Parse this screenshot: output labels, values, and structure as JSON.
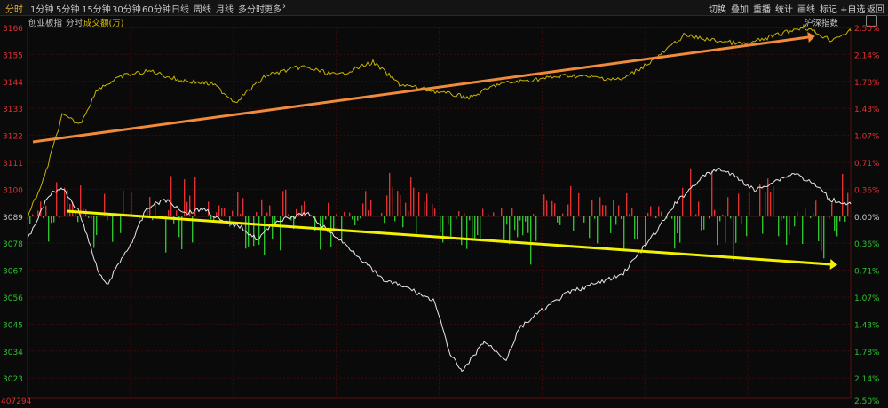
{
  "toolbar": {
    "tabs": [
      "分时",
      "1分钟",
      "5分钟",
      "15分钟",
      "30分钟",
      "60分钟",
      "日线",
      "周线",
      "月线",
      "多分时",
      "更多"
    ],
    "more_arrow": "›",
    "right_tabs": [
      "切换",
      "叠加",
      "重播",
      "统计",
      "画线",
      "标记",
      "+自选",
      "返回"
    ]
  },
  "subheader": {
    "index_name": "创业板指",
    "mode": "分时",
    "volume_label": "成交额(万)",
    "overlay_name": "沪深指数"
  },
  "axis": {
    "left_ticks": [
      "3166",
      "3155",
      "3144",
      "3133",
      "3122",
      "3111",
      "3100",
      "3089",
      "3078",
      "3067",
      "3056",
      "3045",
      "3034",
      "3023"
    ],
    "right_ticks": [
      "2.50%",
      "2.14%",
      "1.78%",
      "1.43%",
      "1.07%",
      "0.71%",
      "0.36%",
      "0.00%",
      "0.36%",
      "0.71%",
      "1.07%",
      "1.43%",
      "1.78%",
      "2.14%"
    ],
    "bottom_left": "407294",
    "bottom_right": "2.50%"
  },
  "colors": {
    "up": "#e03030",
    "down": "#30c030",
    "yellow_line": "#c8b400",
    "white_line": "#e8e8e8",
    "orange_arrow": "#f08a3c",
    "yellow_arrow": "#f2f200"
  }
}
